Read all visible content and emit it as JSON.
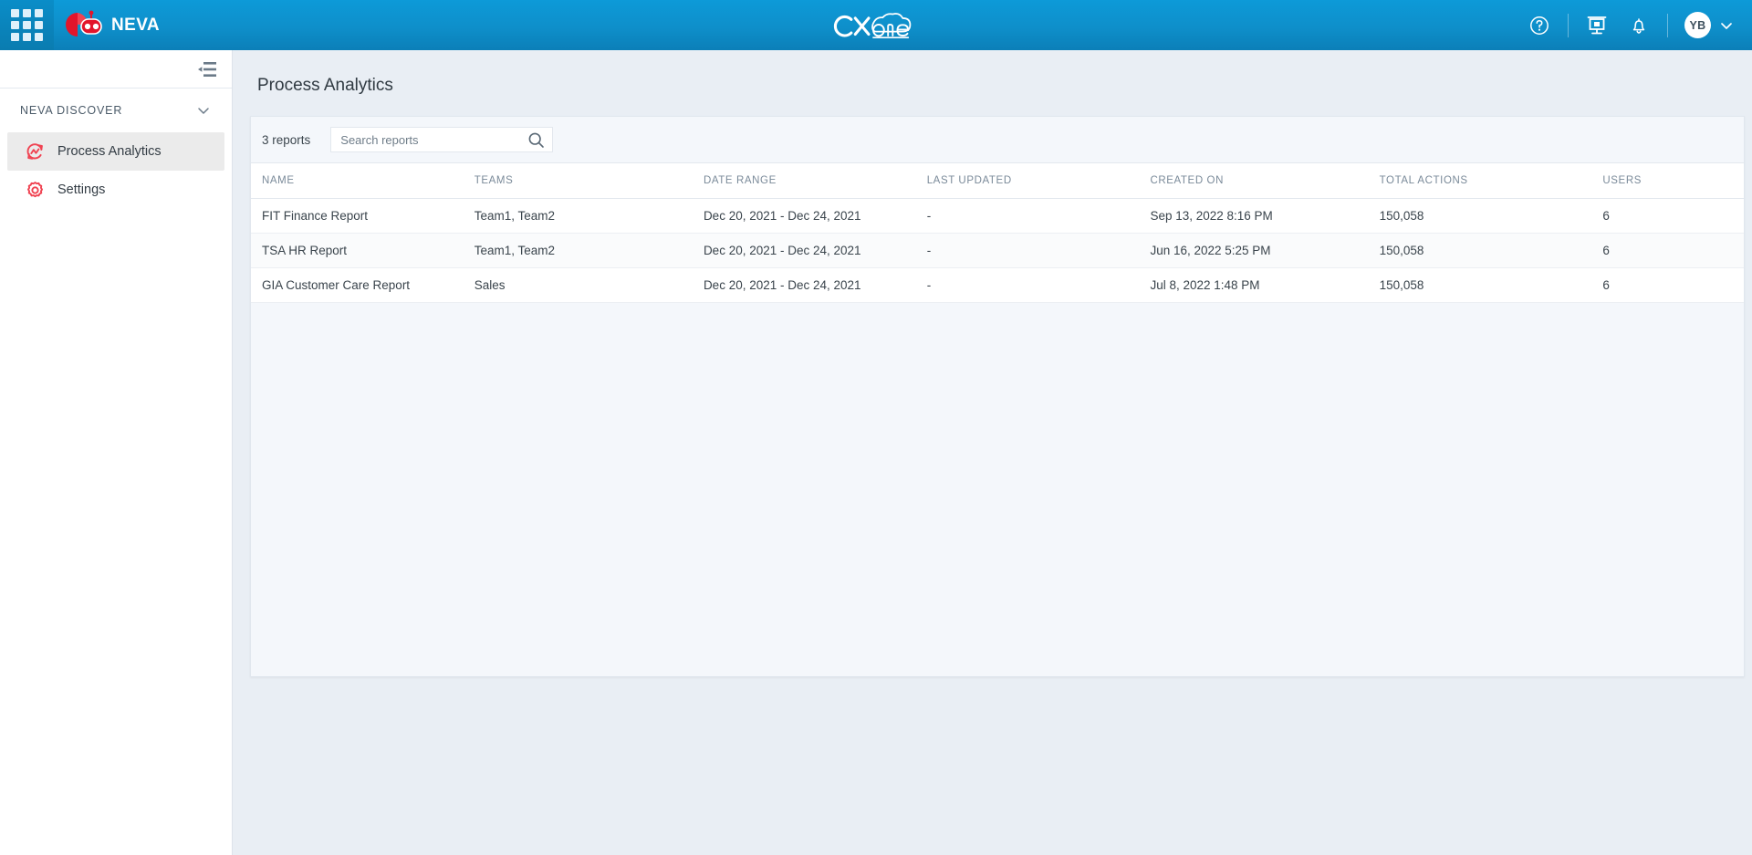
{
  "topbar": {
    "apps_icon": "apps-grid-icon",
    "brand_logo_icon": "neva-robot-logo-icon",
    "brand_name": "NEVA",
    "center_logo_icon": "cxone-logo-icon",
    "center_logo_text": "CXone",
    "help_icon": "help-circle-icon",
    "presentation_icon": "presentation-screen-icon",
    "notifications_icon": "bell-icon",
    "avatar_initials": "YB",
    "avatar_chevron_icon": "chevron-down-icon"
  },
  "sidebar": {
    "collapse_icon": "collapse-menu-icon",
    "section_label": "NEVA DISCOVER",
    "section_chevron_icon": "chevron-down-icon",
    "items": [
      {
        "label": "Process Analytics",
        "icon": "process-analytics-icon",
        "active": true
      },
      {
        "label": "Settings",
        "icon": "gear-icon",
        "active": false
      }
    ]
  },
  "main": {
    "page_title": "Process Analytics",
    "toolbar": {
      "reports_count": "3 reports",
      "search_placeholder": "Search reports",
      "search_value": "",
      "search_icon": "search-icon"
    },
    "table": {
      "columns": [
        "NAME",
        "TEAMS",
        "DATE RANGE",
        "LAST UPDATED",
        "CREATED ON",
        "TOTAL ACTIONS",
        "USERS"
      ],
      "rows": [
        {
          "name": "FIT Finance Report",
          "teams": "Team1, Team2",
          "date_range": "Dec 20, 2021 - Dec 24, 2021",
          "last_updated": "-",
          "created_on": "Sep 13, 2022 8:16 PM",
          "total_actions": "150,058",
          "users": "6"
        },
        {
          "name": "TSA HR Report",
          "teams": "Team1, Team2",
          "date_range": "Dec 20, 2021 - Dec 24, 2021",
          "last_updated": "-",
          "created_on": "Jun 16, 2022 5:25 PM",
          "total_actions": "150,058",
          "users": "6"
        },
        {
          "name": "GIA Customer Care Report",
          "teams": "Sales",
          "date_range": "Dec 20, 2021 - Dec 24, 2021",
          "last_updated": "-",
          "created_on": "Jul 8, 2022 1:48 PM",
          "total_actions": "150,058",
          "users": "6"
        }
      ]
    }
  },
  "colors": {
    "topbar_blue": "#0e8fca",
    "accent_red": "#f04352",
    "page_bg": "#e9eef4",
    "card_bg": "#f4f7fb",
    "table_bg": "#ffffff",
    "header_text": "#7a8a99",
    "body_text": "#3a444c"
  }
}
